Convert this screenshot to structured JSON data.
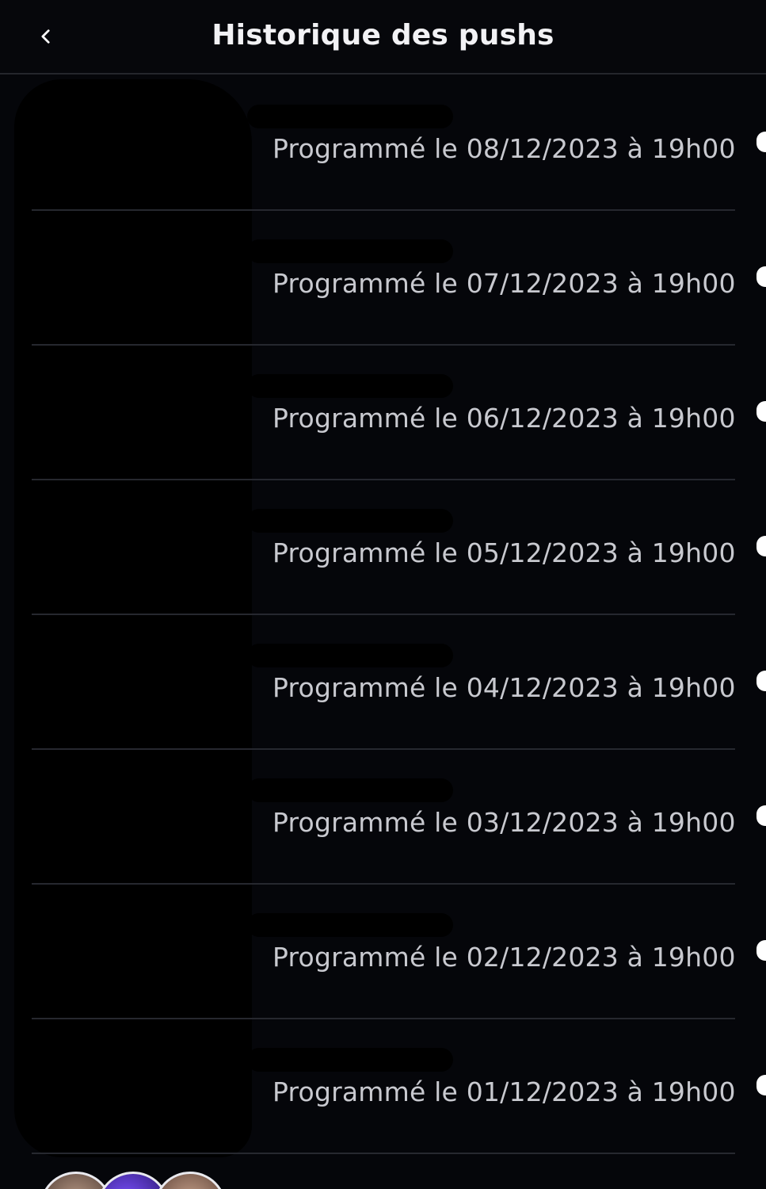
{
  "header": {
    "title": "Historique des pushs",
    "back_icon": "chevron-left-icon"
  },
  "pushes": [
    {
      "scheduled": "Programmé le 08/12/2023 à 19h00"
    },
    {
      "scheduled": "Programmé le 07/12/2023 à 19h00"
    },
    {
      "scheduled": "Programmé le 06/12/2023 à 19h00"
    },
    {
      "scheduled": "Programmé le 05/12/2023 à 19h00"
    },
    {
      "scheduled": "Programmé le 04/12/2023 à 19h00"
    },
    {
      "scheduled": "Programmé le 03/12/2023 à 19h00"
    },
    {
      "scheduled": "Programmé le 02/12/2023 à 19h00"
    },
    {
      "scheduled": "Programmé le 01/12/2023 à 19h00"
    }
  ],
  "colors": {
    "background": "#05060a",
    "title": "#f2f2f5",
    "date_text": "#c8c9cf",
    "divider": "#26282f"
  }
}
